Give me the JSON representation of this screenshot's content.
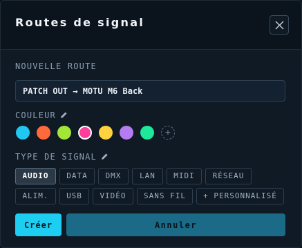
{
  "dialog": {
    "title": "Routes de signal"
  },
  "new_route": {
    "label": "NOUVELLE ROUTE",
    "value": "PATCH OUT → MOTU M6 Back"
  },
  "color": {
    "label": "COULEUR",
    "swatches": [
      "#1ec8f0",
      "#ff6a3d",
      "#a4e636",
      "#ff3d9a",
      "#ffd23f",
      "#b57cf2",
      "#1ee89a"
    ],
    "selected_index": 3,
    "add_symbol": "+"
  },
  "signal_type": {
    "label": "TYPE DE SIGNAL",
    "selected": "AUDIO",
    "row1": [
      "AUDIO",
      "DATA",
      "DMX",
      "LAN",
      "MIDI",
      "RÉSEAU"
    ],
    "row2": [
      "ALIM.",
      "USB",
      "VIDÉO",
      "SANS FIL",
      "+ PERSONNALISÉ"
    ]
  },
  "actions": {
    "create": "Créer",
    "cancel": "Annuler"
  },
  "colors": {
    "accent": "#1ecdf2",
    "cancel_bg": "#1a6a88",
    "panel_bg": "#0f1a25"
  }
}
